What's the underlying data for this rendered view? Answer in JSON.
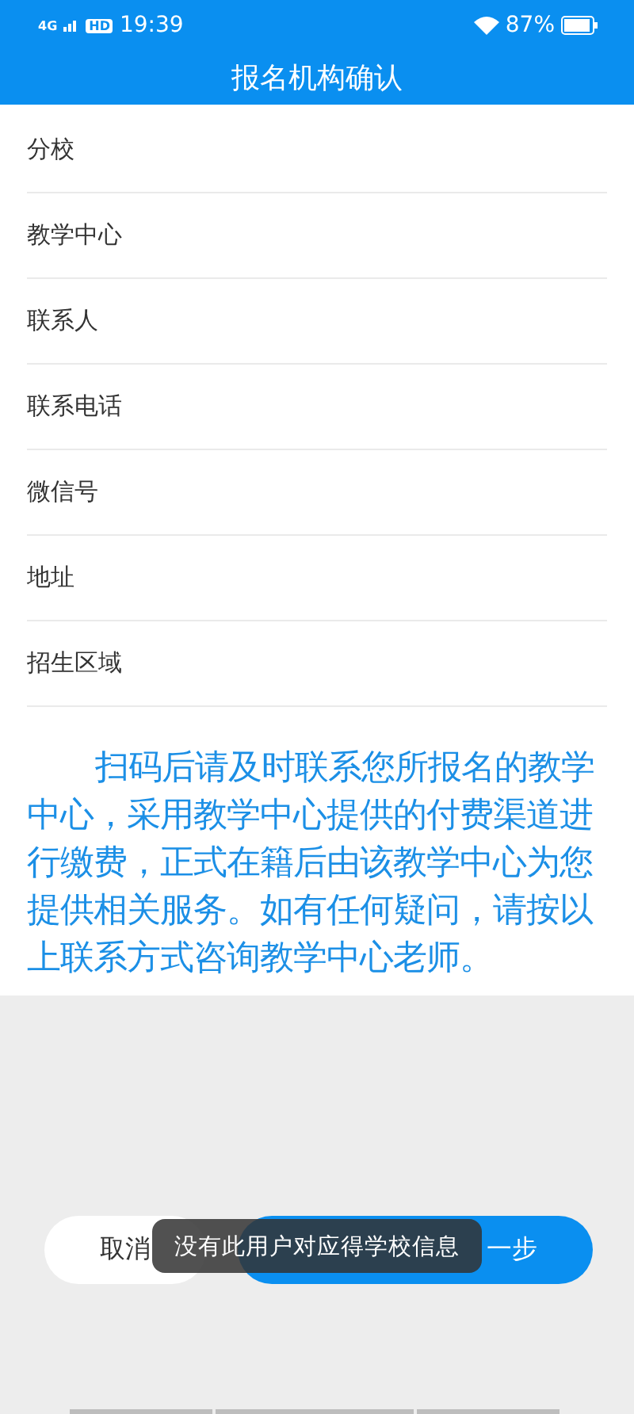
{
  "status_bar": {
    "network": "4G",
    "hd": "HD",
    "time": "19:39",
    "battery": "87%"
  },
  "header": {
    "title": "报名机构确认"
  },
  "fields": [
    {
      "label": "分校"
    },
    {
      "label": "教学中心"
    },
    {
      "label": "联系人"
    },
    {
      "label": "联系电话"
    },
    {
      "label": "微信号"
    },
    {
      "label": "地址"
    },
    {
      "label": "招生区域"
    }
  ],
  "notice": "扫码后请及时联系您所报名的教学中心，采用教学中心提供的付费渠道进行缴费，正式在籍后由该教学中心为您提供相关服务。如有任何疑问，请按以上联系方式咨询教学中心老师。",
  "buttons": {
    "cancel": "取消",
    "next": "一步"
  },
  "toast": "没有此用户对应得学校信息"
}
